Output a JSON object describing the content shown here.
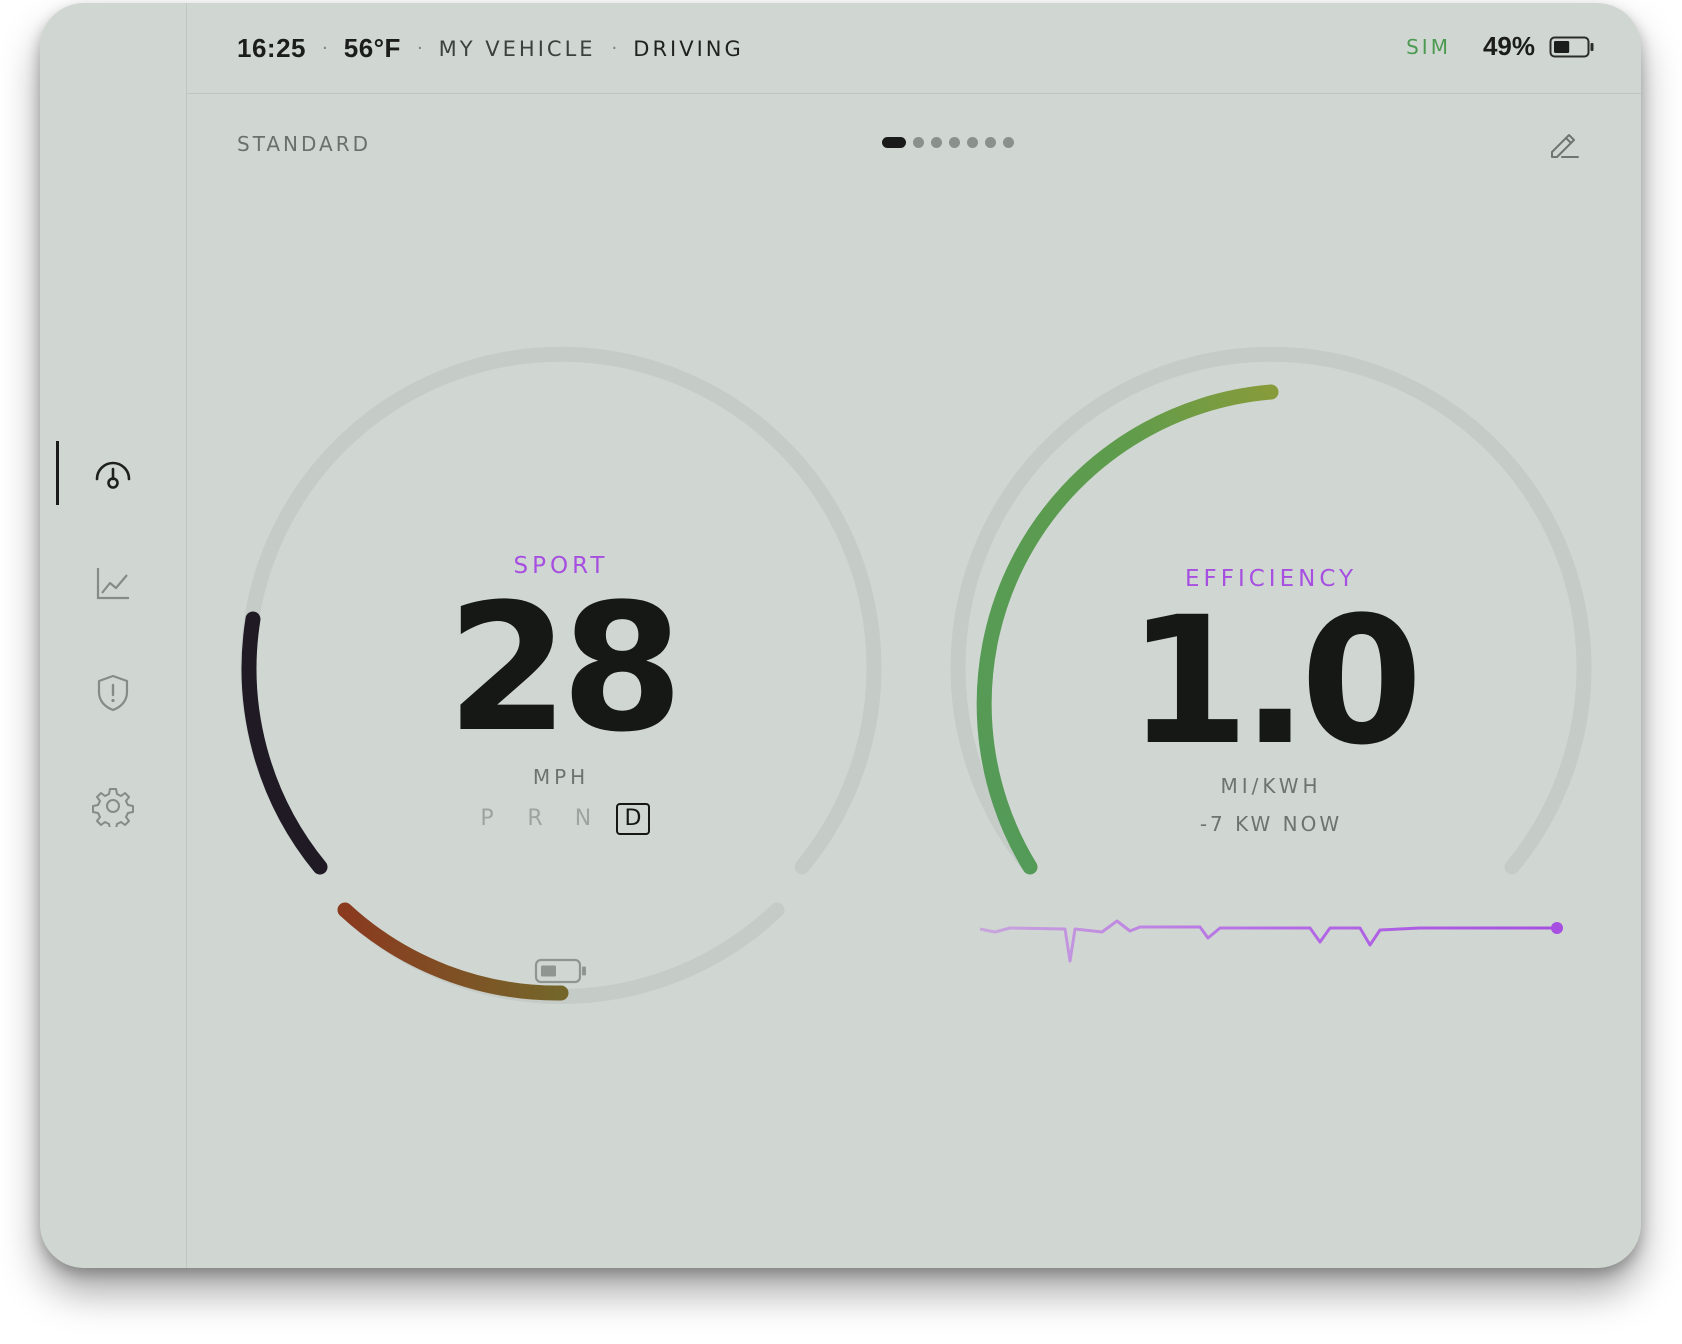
{
  "status": {
    "time": "16:25",
    "temperature": "56°F",
    "vehicle": "MY VEHICLE",
    "state": "DRIVING",
    "sim": "SIM",
    "battery_percent": "49%",
    "battery_level": 0.49
  },
  "sidebar": {
    "items": [
      {
        "id": "gauges",
        "icon": "speedometer-icon",
        "active": true
      },
      {
        "id": "analytics",
        "icon": "chart-line-icon",
        "active": false
      },
      {
        "id": "safety",
        "icon": "shield-alert-icon",
        "active": false
      },
      {
        "id": "settings",
        "icon": "gear-icon",
        "active": false
      }
    ]
  },
  "dashboard": {
    "profile": "STANDARD",
    "pages": 7,
    "active_page": 0,
    "edit_icon": "pencil-icon"
  },
  "speed_gauge": {
    "mode": "SPORT",
    "value": "28",
    "unit": "MPH",
    "gears": [
      "P",
      "R",
      "N",
      "D"
    ],
    "active_gear": "D",
    "battery_icon": "battery-icon"
  },
  "efficiency_gauge": {
    "mode": "EFFICIENCY",
    "value": "1.0",
    "unit": "MI/KWH",
    "power_now": "-7 KW NOW"
  },
  "colors": {
    "accent_purple": "#a64fe0",
    "green": "#5a9a56",
    "sim_green": "#4c9a51",
    "background": "#d0d7d2"
  }
}
